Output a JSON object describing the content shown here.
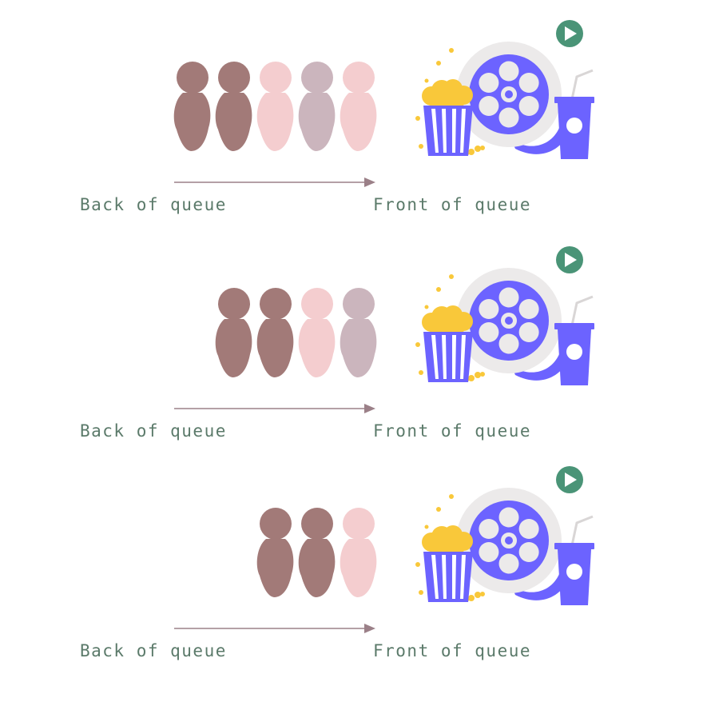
{
  "colors": {
    "label": "#5b7a6a",
    "arrow": "#9b8088",
    "people": [
      "#a27a78",
      "#f4cdcf",
      "#cbb5bd"
    ],
    "reel": "#6c63ff",
    "reel_bg": "#eceaea",
    "popcorn": "#f9c83a",
    "play_button": "#4a9477"
  },
  "icons": {
    "person": "person-icon",
    "popcorn": "popcorn-icon",
    "film_reel": "film-reel-icon",
    "drink": "drink-cup-icon",
    "play": "play-icon"
  },
  "panels": [
    {
      "back_label": "Back of queue",
      "front_label": "Front of queue",
      "people": [
        "#a27a78",
        "#a27a78",
        "#f4cdcf",
        "#cbb5bd",
        "#f4cdcf"
      ]
    },
    {
      "back_label": "Back of queue",
      "front_label": "Front of queue",
      "people": [
        "#a27a78",
        "#a27a78",
        "#f4cdcf",
        "#cbb5bd"
      ]
    },
    {
      "back_label": "Back of queue",
      "front_label": "Front of queue",
      "people": [
        "#a27a78",
        "#a27a78",
        "#f4cdcf"
      ]
    }
  ]
}
